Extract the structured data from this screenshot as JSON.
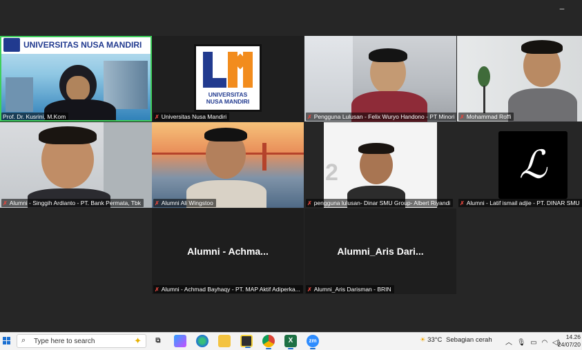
{
  "window": {
    "minimize_glyph": "–"
  },
  "tiles": [
    {
      "label": "Prof. Dr. Kusrini, M.Kom",
      "muted": false,
      "active_speaker": true,
      "banner_text": "UNIVERSITAS NUSA MANDIRI"
    },
    {
      "label": "Universitas Nusa Mandiri",
      "muted": true,
      "logo_line1": "UNIVERSITAS",
      "logo_line2": "NUSA MANDIRI"
    },
    {
      "label": "Pengguna Lulusan - Felix Wuryo Handono - PT Minori",
      "muted": true
    },
    {
      "label": "Mohammad Roffi",
      "muted": true
    },
    {
      "label": "Alumni - Singgih Ardianto - PT. Bank Permata, Tbk",
      "muted": true
    },
    {
      "label": "Alumni Ali Wingstoo",
      "muted": true
    },
    {
      "label": "pengguna lulusan- Dinar SMU Group- Albert Riyandi",
      "muted": true
    },
    {
      "label": "Alumni - Latif ismail adjie - PT. DINAR SMU",
      "muted": true,
      "avatar_letter": "ℒ"
    },
    {
      "label": "Alumni - Achmad Bayhaqy - PT. MAP Aktif Adiperka...",
      "muted": true,
      "display_name": "Alumni  -  Achma..."
    },
    {
      "label": "Alumni_Aris Darisman - BRIN",
      "muted": true,
      "display_name": "Alumni_Aris  Dari..."
    }
  ],
  "taskbar": {
    "search_placeholder": "Type here to search",
    "apps": [
      "task-view",
      "copilot",
      "edge",
      "file-explorer",
      "sticky-notes",
      "chrome",
      "excel",
      "zoom"
    ],
    "weather": {
      "temp": "33°C",
      "condition": "Sebagian cerah"
    },
    "time": "14.26",
    "date": "24/07/20"
  }
}
